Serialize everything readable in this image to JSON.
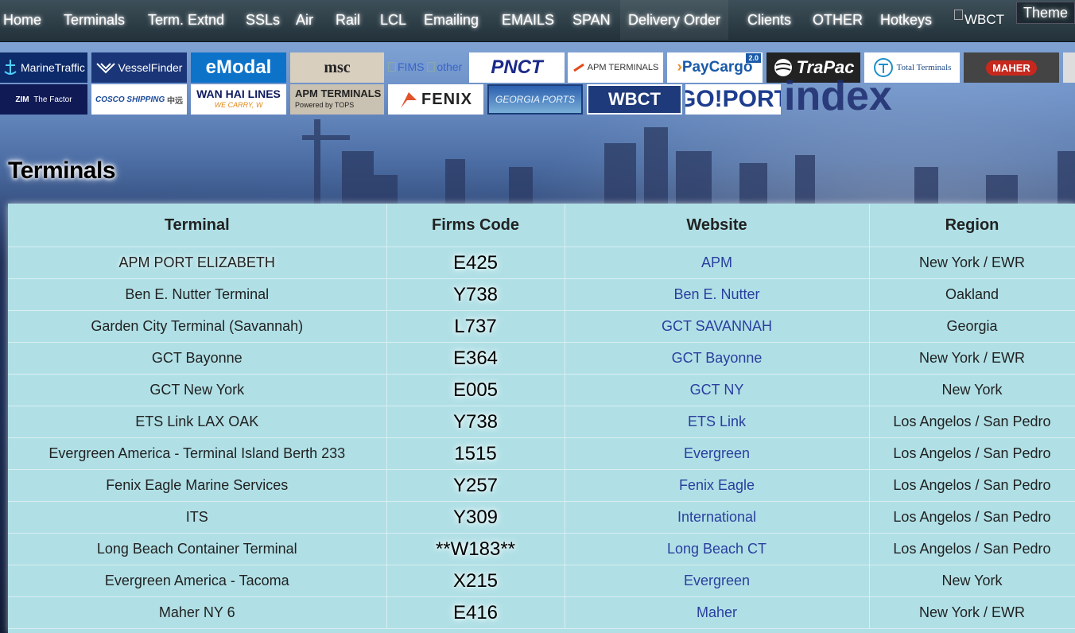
{
  "nav": {
    "items": [
      "Home",
      "Terminals",
      "Term. Extnd",
      "SSLs",
      "Air",
      "Rail",
      "LCL",
      "Emailing",
      "EMAILS",
      "SPAN",
      "Delivery Order",
      "Clients",
      "OTHER",
      "Hotkeys"
    ],
    "broken_image_alt": "WBCT",
    "theme_label": "Theme"
  },
  "logos": {
    "row1": [
      "MarineTraffic",
      "VesselFinder",
      "eModal",
      "msc",
      "PNCT",
      "APM TERMINALS",
      "PayCargo",
      "TraPac",
      "Total Terminals",
      "MAHER"
    ],
    "row2": [
      "ZIM",
      "The Factor",
      "COSCO SHIPPING",
      "中远",
      "WAN HAI LINES",
      "WE CARRY, W",
      "APM TERMINALS",
      "Powered by TOPS",
      "FENIX",
      "GEORGIA PORTS",
      "WBCT",
      "GO!PORT"
    ],
    "broken": [
      "FIMS",
      "other"
    ],
    "paycargo_badge": "2.0",
    "background_text": "index"
  },
  "page": {
    "title": "Terminals"
  },
  "table": {
    "headers": [
      "Terminal",
      "Firms Code",
      "Website",
      "Region"
    ],
    "rows": [
      [
        "APM PORT ELIZABETH",
        "E425",
        "APM",
        "New York / EWR"
      ],
      [
        "Ben E. Nutter Terminal",
        "Y738",
        "Ben E. Nutter",
        "Oakland"
      ],
      [
        "Garden City Terminal (Savannah)",
        "L737",
        "GCT SAVANNAH",
        "Georgia"
      ],
      [
        "GCT Bayonne",
        "E364",
        "GCT Bayonne",
        "New York / EWR"
      ],
      [
        "GCT New York",
        "E005",
        "GCT NY",
        "New York"
      ],
      [
        "ETS Link LAX OAK",
        "Y738",
        "ETS Link",
        "Los Angelos / San Pedro"
      ],
      [
        "Evergreen America - Terminal Island Berth 233",
        "1515",
        "Evergreen",
        "Los Angelos / San Pedro"
      ],
      [
        "Fenix Eagle Marine Services",
        "Y257",
        "Fenix Eagle",
        "Los Angelos / San Pedro"
      ],
      [
        "ITS",
        "Y309",
        "International",
        "Los Angelos / San Pedro"
      ],
      [
        "Long Beach Container Terminal",
        "**W183**",
        "Long Beach CT",
        "Los Angelos / San Pedro"
      ],
      [
        "Evergreen America - Tacoma",
        "X215",
        "Evergreen",
        "New York"
      ],
      [
        "Maher NY 6",
        "E416",
        "Maher",
        "New York / EWR"
      ]
    ]
  }
}
